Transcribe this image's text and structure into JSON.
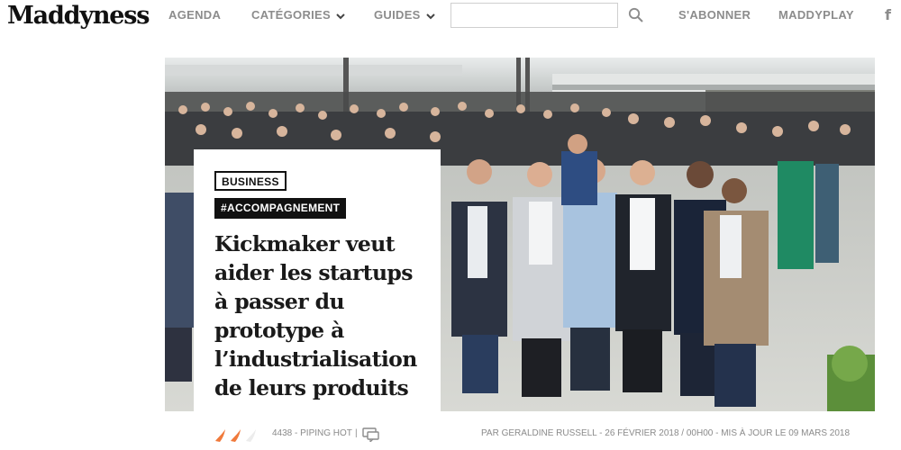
{
  "header": {
    "logo": "Maddyness",
    "nav": [
      {
        "label": "AGENDA"
      },
      {
        "label": "CATÉGORIES",
        "dropdown": true
      },
      {
        "label": "GUIDES",
        "dropdown": true
      }
    ],
    "search": {
      "value": "",
      "placeholder": "",
      "icon": "search-icon"
    },
    "subscribe_label": "S'ABONNER",
    "maddyplay_label": "MADDYPLAY",
    "social_icon": "facebook-icon",
    "social_glyph": "f"
  },
  "article": {
    "category": "BUSINESS",
    "hashtag": "#ACCOMPAGNEMENT",
    "title": "Kickmaker veut aider les startups à passer du prototype à l’industrialisation de leurs produits",
    "hero_image": "Group of young men in business attire posing in a crowded atrium"
  },
  "meta": {
    "score": "4438 - PIPING HOT",
    "separator": "|",
    "byline": "PAR GERALDINE RUSSELL - 26 FÉVRIER 2018 / 00H00 - MIS À JOUR LE 09 MARS 2018",
    "heat_icon": "flame-icon",
    "comment_icon": "comment-icon"
  },
  "colors": {
    "nav_text": "#8c8c8c",
    "tag_bg": "#111111",
    "flame": "#f07a3c",
    "meta_text": "#8a8a8a"
  }
}
